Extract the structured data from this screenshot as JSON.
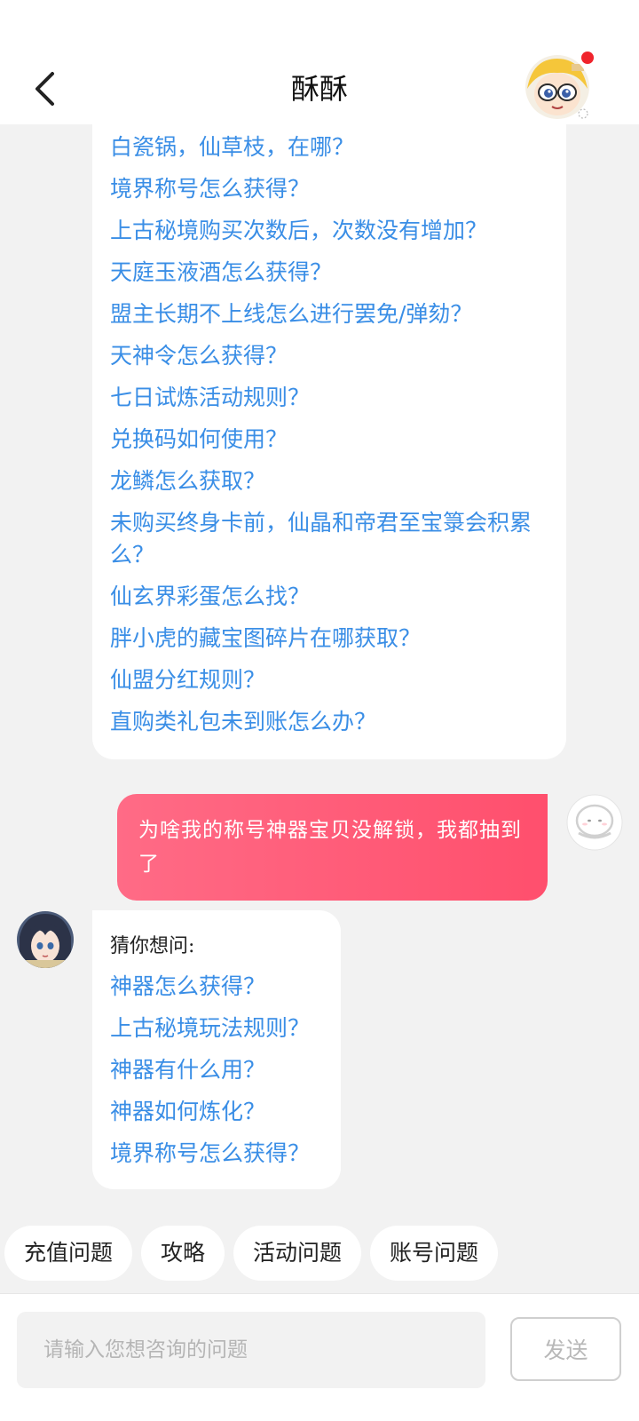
{
  "header": {
    "title": "酥酥"
  },
  "conversation": {
    "faq_questions": [
      "白瓷锅，仙草枝，在哪？",
      "境界称号怎么获得？",
      "上古秘境购买次数后，次数没有增加？",
      "天庭玉液酒怎么获得？",
      "盟主长期不上线怎么进行罢免/弹劾？",
      "天神令怎么获得？",
      "七日试炼活动规则？",
      "兑换码如何使用？",
      "龙鳞怎么获取？",
      "未购买终身卡前，仙晶和帝君至宝箓会积累么？",
      "仙玄界彩蛋怎么找？",
      "胖小虎的藏宝图碎片在哪获取？",
      "仙盟分红规则？",
      "直购类礼包未到账怎么办？"
    ],
    "user_message": "为啥我的称号神器宝贝没解锁，我都抽到了",
    "bot_reply": {
      "guess_label": "猜你想问:",
      "questions": [
        "神器怎么获得？",
        "上古秘境玩法规则？",
        "神器有什么用？",
        "神器如何炼化？",
        "境界称号怎么获得？"
      ]
    }
  },
  "quick_categories": [
    "充值问题",
    "攻略",
    "活动问题",
    "账号问题"
  ],
  "composer": {
    "placeholder": "请输入您想咨询的问题",
    "send_label": "发送"
  },
  "colors": {
    "link": "#3a8ee6",
    "user_bubble": "#ff5a76",
    "notification_dot": "#f0242c"
  }
}
